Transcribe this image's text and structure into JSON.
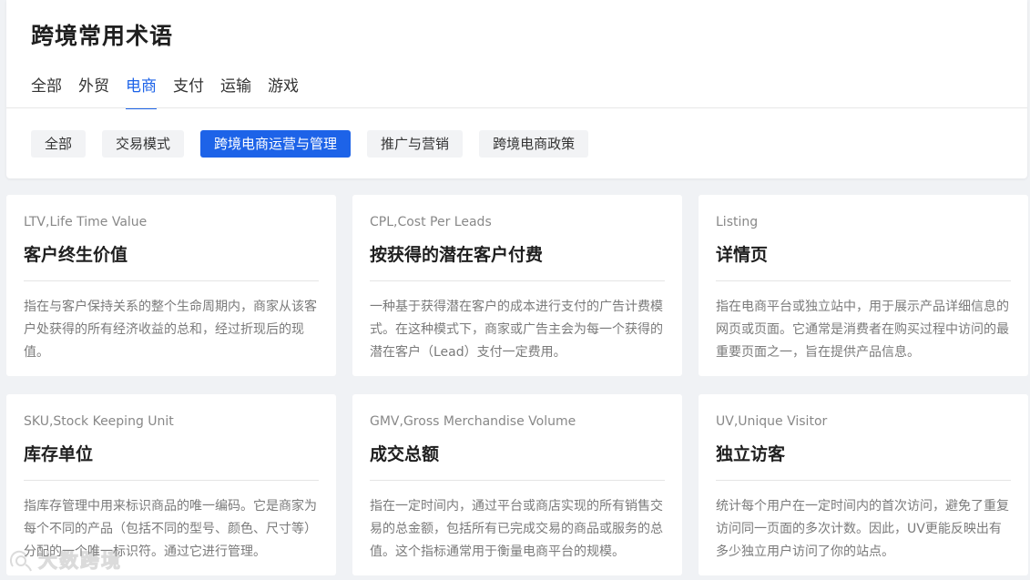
{
  "header": {
    "title": "跨境常用术语",
    "tabs": [
      "全部",
      "外贸",
      "电商",
      "支付",
      "运输",
      "游戏"
    ],
    "active_tab": "电商",
    "sub_tabs": [
      "全部",
      "交易模式",
      "跨境电商运营与管理",
      "推广与营销",
      "跨境电商政策"
    ],
    "active_sub_tab": "跨境电商运营与管理"
  },
  "cards": [
    {
      "en": "LTV,Life Time Value",
      "title": "客户终生价值",
      "desc": "指在与客户保持关系的整个生命周期内，商家从该客户处获得的所有经济收益的总和，经过折现后的现值。"
    },
    {
      "en": "CPL,Cost Per Leads",
      "title": "按获得的潜在客户付费",
      "desc": "一种基于获得潜在客户的成本进行支付的广告计费模式。在这种模式下，商家或广告主会为每一个获得的潜在客户（Lead）支付一定费用。"
    },
    {
      "en": "Listing",
      "title": "详情页",
      "desc": "指在电商平台或独立站中，用于展示产品详细信息的网页或页面。它通常是消费者在购买过程中访问的最重要页面之一，旨在提供产品信息。"
    },
    {
      "en": "SKU,Stock Keeping Unit",
      "title": "库存单位",
      "desc": "指库存管理中用来标识商品的唯一编码。它是商家为每个不同的产品（包括不同的型号、颜色、尺寸等）分配的一个唯一标识符。通过它进行管理。"
    },
    {
      "en": "GMV,Gross Merchandise Volume",
      "title": "成交总额",
      "desc": "指在一定时间内，通过平台或商店实现的所有销售交易的总金额，包括所有已完成交易的商品或服务的总值。这个指标通常用于衡量电商平台的规模。"
    },
    {
      "en": "UV,Unique Visitor",
      "title": "独立访客",
      "desc": "统计每个用户在一定时间内的首次访问，避免了重复访问同一页面的多次计数。因此，UV更能反映出有多少独立用户访问了你的站点。"
    }
  ],
  "watermark": {
    "text": "大数跨境"
  },
  "colors": {
    "accent": "#1d63e8",
    "background": "#f0f2f5"
  }
}
